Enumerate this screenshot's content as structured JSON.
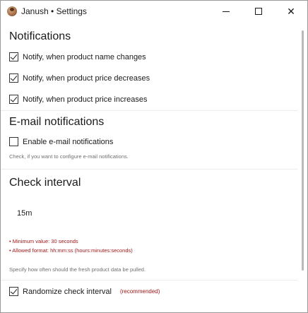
{
  "window": {
    "title": "Janush • Settings",
    "icon": "janush-app-icon"
  },
  "controls": {
    "minimize_icon": "minimize-icon",
    "maximize_icon": "maximize-icon",
    "close_icon": "close-icon",
    "close_glyph": "✕"
  },
  "notifications": {
    "heading": "Notifications",
    "items": [
      {
        "label": "Notify, when product name changes",
        "checked": true
      },
      {
        "label": "Notify, when product price decreases",
        "checked": true
      },
      {
        "label": "Notify, when product price increases",
        "checked": true
      }
    ]
  },
  "email": {
    "heading": "E-mail notifications",
    "enable_label": "Enable e-mail notifications",
    "enable_checked": false,
    "hint": "Check, if you want to configure e-mail notifications."
  },
  "interval": {
    "heading": "Check interval",
    "value": "15m",
    "errors": [
      "• Minimum value: 30 seconds",
      "• Allowed format: hh:mm:ss (hours:minutes:seconds)"
    ],
    "hint": "Specify how often should the fresh product data be pulled.",
    "randomize_label": "Randomize check interval",
    "randomize_checked": true,
    "recommended": "(recommended)"
  },
  "colors": {
    "error": "#a01818",
    "hint": "#707070"
  }
}
